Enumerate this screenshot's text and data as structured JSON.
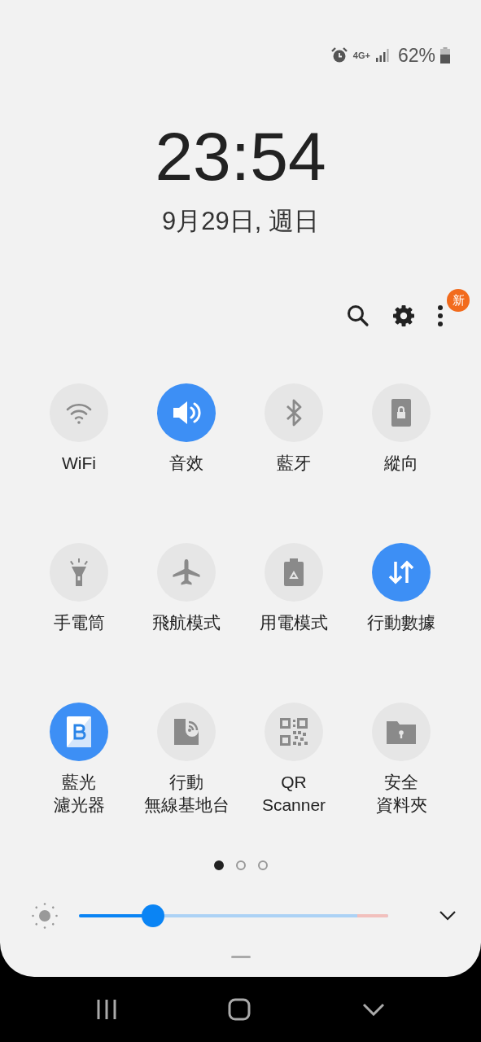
{
  "status_bar": {
    "network": "4G+",
    "battery": "62%"
  },
  "clock": {
    "time": "23:54",
    "date": "9月29日, 週日"
  },
  "toolbar": {
    "badge": "新"
  },
  "tiles": [
    {
      "label": "WiFi",
      "kind": "wifi",
      "on": false
    },
    {
      "label": "音效",
      "kind": "sound",
      "on": true
    },
    {
      "label": "藍牙",
      "kind": "bluetooth",
      "on": false
    },
    {
      "label": "縱向",
      "kind": "rotation",
      "on": false
    },
    {
      "label": "手電筒",
      "kind": "flashlight",
      "on": false
    },
    {
      "label": "飛航模式",
      "kind": "airplane",
      "on": false
    },
    {
      "label": "用電模式",
      "kind": "power",
      "on": false
    },
    {
      "label": "行動數據",
      "kind": "data",
      "on": true
    },
    {
      "label": "藍光",
      "label_line_2": "濾光器",
      "kind": "bluelight",
      "on": true
    },
    {
      "label": "行動",
      "label_line_2": "無線基地台",
      "kind": "hotspot",
      "on": false
    },
    {
      "label": "QR",
      "label_line_2": "Scanner",
      "kind": "qr",
      "on": false
    },
    {
      "label": "安全",
      "label_line_2": "資料夾",
      "kind": "folder",
      "on": false
    }
  ],
  "pages": [
    {
      "selected": true
    },
    {
      "selected": false
    },
    {
      "selected": false
    }
  ],
  "brightness": {
    "level": 0.24
  }
}
